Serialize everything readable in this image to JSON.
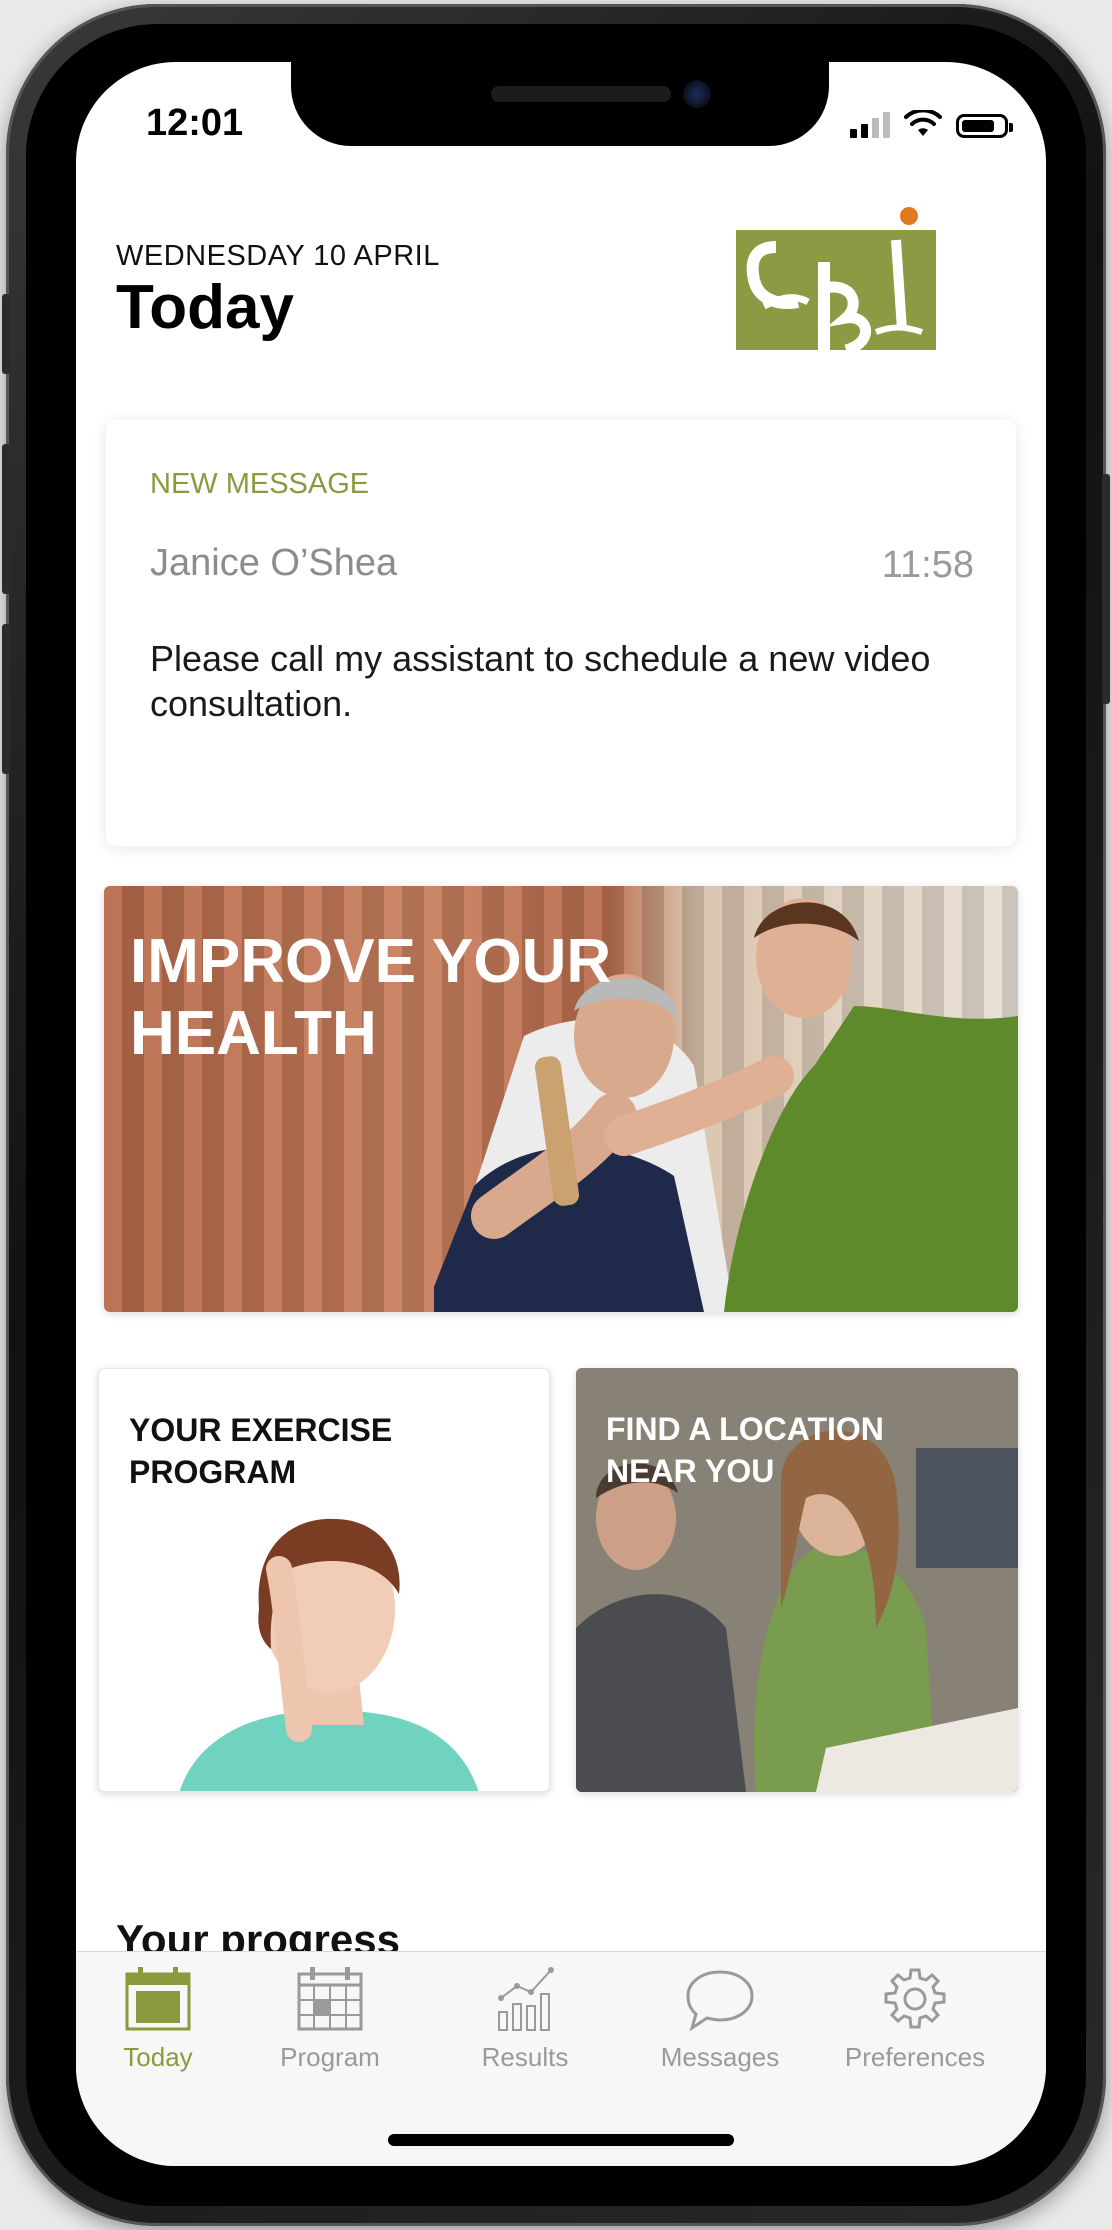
{
  "status_bar": {
    "time": "12:01"
  },
  "header": {
    "date": "WEDNESDAY 10 APRIL",
    "title": "Today"
  },
  "message_card": {
    "tag": "NEW MESSAGE",
    "sender": "Janice O’Shea",
    "time": "11:58",
    "body": "Please call my assistant to schedule a new video consultation."
  },
  "hero": {
    "title": "IMPROVE YOUR HEALTH"
  },
  "tiles": [
    {
      "title": "YOUR EXERCISE PROGRAM"
    },
    {
      "title": "FIND A LOCATION NEAR YOU"
    }
  ],
  "progress": {
    "heading": "Your progress"
  },
  "tab_bar": {
    "items": [
      {
        "label": "Today",
        "icon": "calendar-icon",
        "active": true
      },
      {
        "label": "Program",
        "icon": "calendar-grid-icon",
        "active": false
      },
      {
        "label": "Results",
        "icon": "bar-chart-icon",
        "active": false
      },
      {
        "label": "Messages",
        "icon": "speech-bubble-icon",
        "active": false
      },
      {
        "label": "Preferences",
        "icon": "gear-icon",
        "active": false
      }
    ]
  },
  "colors": {
    "accent": "#8a9a3e",
    "logo_green": "#8c9a43",
    "logo_dot": "#e07a1f"
  }
}
